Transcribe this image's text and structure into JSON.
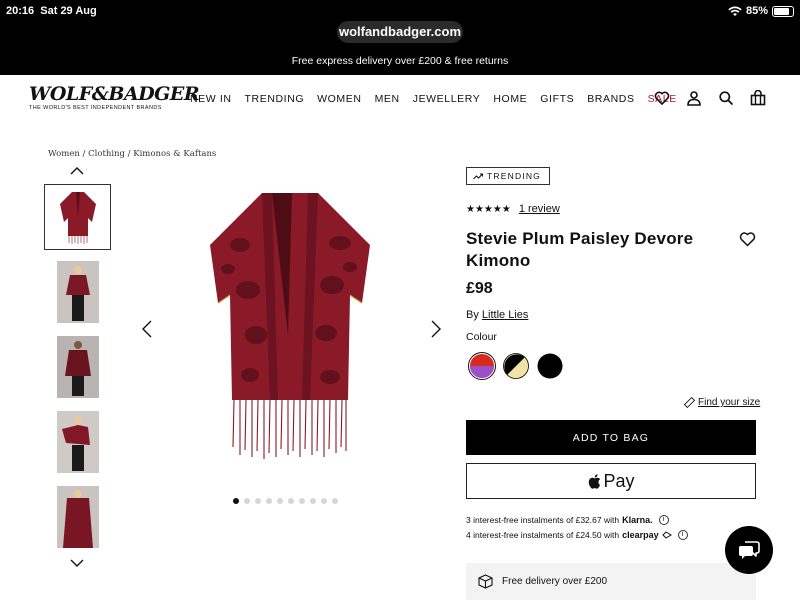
{
  "status_bar": {
    "time": "20:16",
    "date": "Sat 29 Aug",
    "battery": "85%",
    "battery_level": 0.85
  },
  "browser": {
    "url": "wolfandbadger.com"
  },
  "promo": "Free express delivery over £200 & free returns",
  "logo": {
    "name": "WOLF&BADGER",
    "tagline": "THE WORLD'S BEST INDEPENDENT BRANDS"
  },
  "nav": {
    "items": [
      "NEW IN",
      "TRENDING",
      "WOMEN",
      "MEN",
      "JEWELLERY",
      "HOME",
      "GIFTS",
      "BRANDS",
      "SALE"
    ],
    "icons": [
      "heart-icon",
      "account-icon",
      "search-icon",
      "bag-icon"
    ]
  },
  "breadcrumb": "Women / Clothing / Kimonos & Kaftans",
  "gallery": {
    "thumbnail_count": 5,
    "dot_count": 10,
    "active_dot": 1
  },
  "product": {
    "badge": "TRENDING",
    "stars": "★★★★★",
    "review_text": "1 review",
    "title": "Stevie Plum Paisley Devore Kimono",
    "price": "£98",
    "by_prefix": "By",
    "brand": "Little Lies",
    "colour_label": "Colour",
    "find_size": "Find your size",
    "add_to_bag": "ADD TO BAG",
    "apple_pay": "Pay"
  },
  "installments": [
    {
      "text": "3 interest-free instalments of £32.67 with",
      "provider": "Klarna."
    },
    {
      "text": "4 interest-free instalments of £24.50 with",
      "provider": "clearpay"
    }
  ],
  "delivery": {
    "text": "Free delivery over £200"
  },
  "colors": {
    "brand_red": "#b3182b",
    "product_burgundy": "#8a1a28",
    "black": "#000000"
  }
}
